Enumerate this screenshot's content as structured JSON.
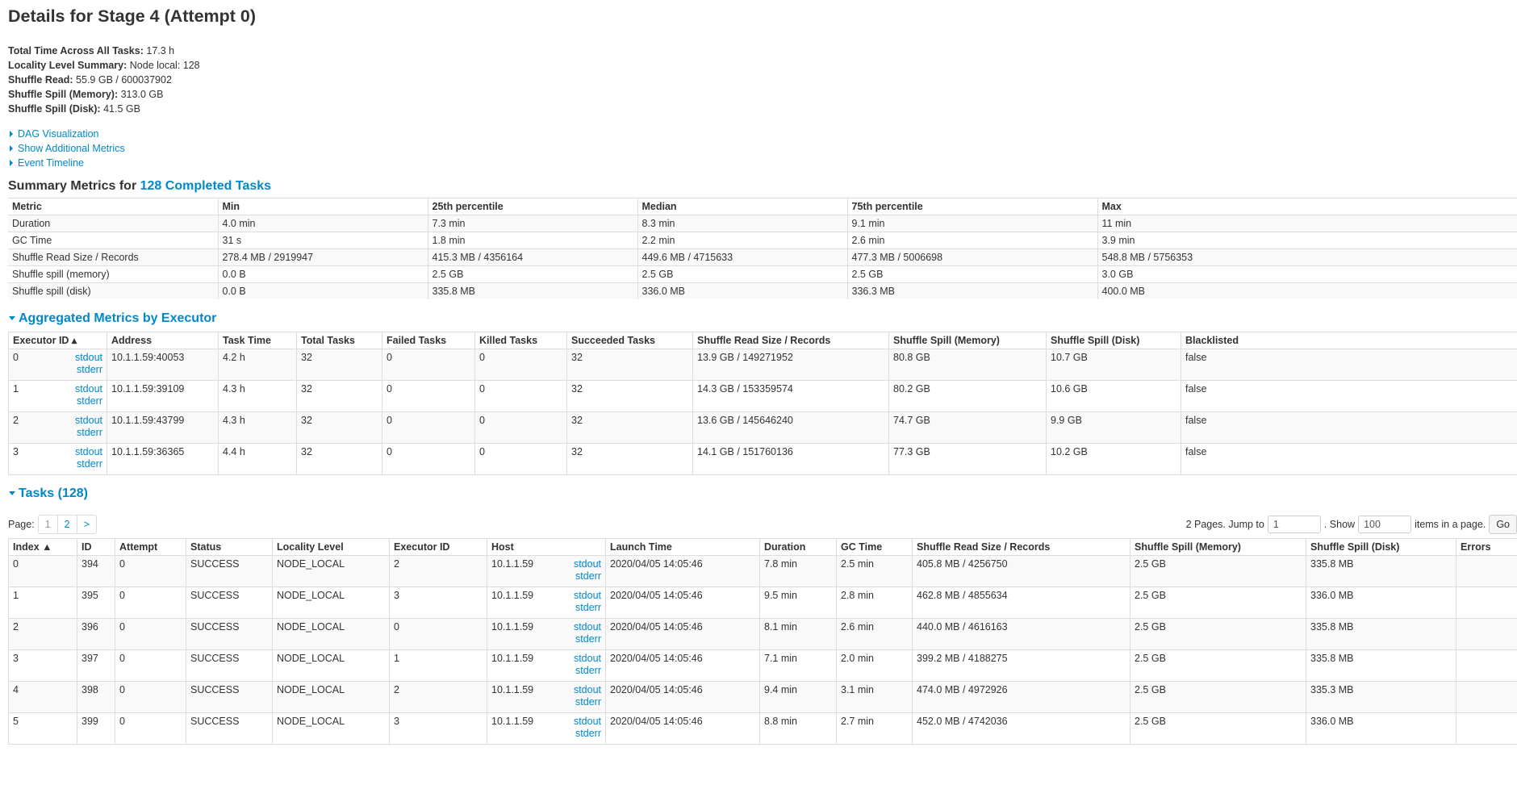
{
  "title": "Details for Stage 4 (Attempt 0)",
  "summary": [
    {
      "label": "Total Time Across All Tasks:",
      "value": "17.3 h"
    },
    {
      "label": "Locality Level Summary:",
      "value": "Node local: 128"
    },
    {
      "label": "Shuffle Read:",
      "value": "55.9 GB / 600037902"
    },
    {
      "label": "Shuffle Spill (Memory):",
      "value": "313.0 GB"
    },
    {
      "label": "Shuffle Spill (Disk):",
      "value": "41.5 GB"
    }
  ],
  "toggles": [
    "DAG Visualization",
    "Show Additional Metrics",
    "Event Timeline"
  ],
  "summary_metrics": {
    "heading_prefix": "Summary Metrics for",
    "heading_link": "128 Completed Tasks",
    "columns": [
      "Metric",
      "Min",
      "25th percentile",
      "Median",
      "75th percentile",
      "Max"
    ],
    "rows": [
      [
        "Duration",
        "4.0 min",
        "7.3 min",
        "8.3 min",
        "9.1 min",
        "11 min"
      ],
      [
        "GC Time",
        "31 s",
        "1.8 min",
        "2.2 min",
        "2.6 min",
        "3.9 min"
      ],
      [
        "Shuffle Read Size / Records",
        "278.4 MB / 2919947",
        "415.3 MB / 4356164",
        "449.6 MB / 4715633",
        "477.3 MB / 5006698",
        "548.8 MB / 5756353"
      ],
      [
        "Shuffle spill (memory)",
        "0.0 B",
        "2.5 GB",
        "2.5 GB",
        "2.5 GB",
        "3.0 GB"
      ],
      [
        "Shuffle spill (disk)",
        "0.0 B",
        "335.8 MB",
        "336.0 MB",
        "336.3 MB",
        "400.0 MB"
      ]
    ]
  },
  "executors": {
    "heading": "Aggregated Metrics by Executor",
    "columns": [
      "Executor ID ▴",
      "Address",
      "Task Time",
      "Total Tasks",
      "Failed Tasks",
      "Killed Tasks",
      "Succeeded Tasks",
      "Shuffle Read Size / Records",
      "Shuffle Spill (Memory)",
      "Shuffle Spill (Disk)",
      "Blacklisted"
    ],
    "stdout": "stdout",
    "stderr": "stderr",
    "rows": [
      [
        "0",
        "10.1.1.59:40053",
        "4.2 h",
        "32",
        "0",
        "0",
        "32",
        "13.9 GB / 149271952",
        "80.8 GB",
        "10.7 GB",
        "false"
      ],
      [
        "1",
        "10.1.1.59:39109",
        "4.3 h",
        "32",
        "0",
        "0",
        "32",
        "14.3 GB / 153359574",
        "80.2 GB",
        "10.6 GB",
        "false"
      ],
      [
        "2",
        "10.1.1.59:43799",
        "4.3 h",
        "32",
        "0",
        "0",
        "32",
        "13.6 GB / 145646240",
        "74.7 GB",
        "9.9 GB",
        "false"
      ],
      [
        "3",
        "10.1.1.59:36365",
        "4.4 h",
        "32",
        "0",
        "0",
        "32",
        "14.1 GB / 151760136",
        "77.3 GB",
        "10.2 GB",
        "false"
      ]
    ]
  },
  "tasks": {
    "heading": "Tasks (128)",
    "pager": {
      "label": "Page:",
      "pages": [
        "1",
        "2",
        ">"
      ],
      "pages_info": "2 Pages. Jump to",
      "jump_value": "1",
      "show_label": ". Show",
      "show_value": "100",
      "items_label": "items in a page.",
      "go_label": "Go"
    },
    "columns": [
      "Index ▲",
      "ID",
      "Attempt",
      "Status",
      "Locality Level",
      "Executor ID",
      "Host",
      "Launch Time",
      "Duration",
      "GC Time",
      "Shuffle Read Size / Records",
      "Shuffle Spill (Memory)",
      "Shuffle Spill (Disk)",
      "Errors"
    ],
    "stdout": "stdout",
    "stderr": "stderr",
    "rows": [
      [
        "0",
        "394",
        "0",
        "SUCCESS",
        "NODE_LOCAL",
        "2",
        "10.1.1.59",
        "2020/04/05 14:05:46",
        "7.8 min",
        "2.5 min",
        "405.8 MB / 4256750",
        "2.5 GB",
        "335.8 MB",
        ""
      ],
      [
        "1",
        "395",
        "0",
        "SUCCESS",
        "NODE_LOCAL",
        "3",
        "10.1.1.59",
        "2020/04/05 14:05:46",
        "9.5 min",
        "2.8 min",
        "462.8 MB / 4855634",
        "2.5 GB",
        "336.0 MB",
        ""
      ],
      [
        "2",
        "396",
        "0",
        "SUCCESS",
        "NODE_LOCAL",
        "0",
        "10.1.1.59",
        "2020/04/05 14:05:46",
        "8.1 min",
        "2.6 min",
        "440.0 MB / 4616163",
        "2.5 GB",
        "335.8 MB",
        ""
      ],
      [
        "3",
        "397",
        "0",
        "SUCCESS",
        "NODE_LOCAL",
        "1",
        "10.1.1.59",
        "2020/04/05 14:05:46",
        "7.1 min",
        "2.0 min",
        "399.2 MB / 4188275",
        "2.5 GB",
        "335.8 MB",
        ""
      ],
      [
        "4",
        "398",
        "0",
        "SUCCESS",
        "NODE_LOCAL",
        "2",
        "10.1.1.59",
        "2020/04/05 14:05:46",
        "9.4 min",
        "3.1 min",
        "474.0 MB / 4972926",
        "2.5 GB",
        "335.3 MB",
        ""
      ],
      [
        "5",
        "399",
        "0",
        "SUCCESS",
        "NODE_LOCAL",
        "3",
        "10.1.1.59",
        "2020/04/05 14:05:46",
        "8.8 min",
        "2.7 min",
        "452.0 MB / 4742036",
        "2.5 GB",
        "336.0 MB",
        ""
      ]
    ]
  }
}
